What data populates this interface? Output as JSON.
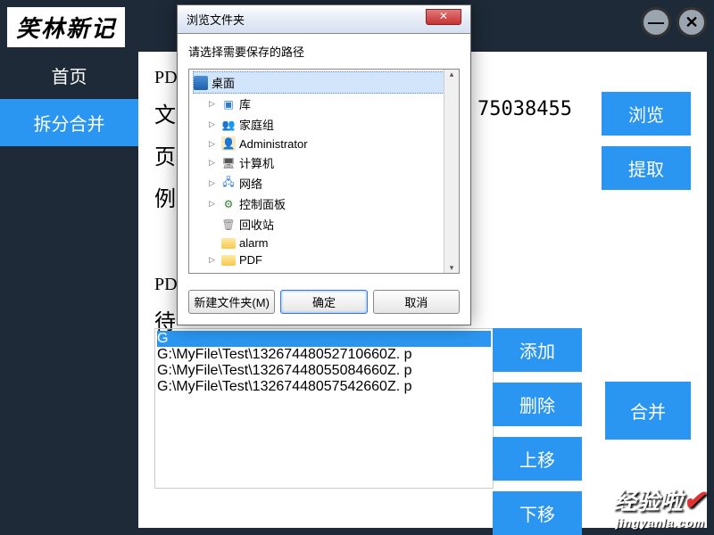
{
  "app": {
    "logo_text": "笑林新记"
  },
  "sidebar": {
    "items": [
      {
        "label": "首页"
      },
      {
        "label": "拆分合并"
      }
    ]
  },
  "main": {
    "section1_prefix": "PD",
    "row1_label": "文",
    "row2_label": "页",
    "row3_label": "例",
    "path_fragment": "75038455",
    "browse_btn": "浏览",
    "extract_btn": "提取",
    "section2_prefix": "PD",
    "section2_row_label": "待",
    "add_btn": "添加",
    "delete_btn": "删除",
    "up_btn": "上移",
    "down_btn": "下移",
    "merge_btn": "合并",
    "file_list": [
      "G",
      "G:\\MyFile\\Test\\13267448052710660Z. p",
      "G:\\MyFile\\Test\\13267448055084660Z. p",
      "G:\\MyFile\\Test\\13267448057542660Z. p"
    ]
  },
  "dialog": {
    "title": "浏览文件夹",
    "instruction": "请选择需要保存的路径",
    "tree": [
      {
        "label": "桌面",
        "type": "desktop",
        "root": true
      },
      {
        "label": "库",
        "type": "lib"
      },
      {
        "label": "家庭组",
        "type": "home"
      },
      {
        "label": "Administrator",
        "type": "user"
      },
      {
        "label": "计算机",
        "type": "pc"
      },
      {
        "label": "网络",
        "type": "net"
      },
      {
        "label": "控制面板",
        "type": "cp"
      },
      {
        "label": "回收站",
        "type": "bin"
      },
      {
        "label": "alarm",
        "type": "folder"
      },
      {
        "label": "PDF",
        "type": "folder"
      }
    ],
    "new_folder_btn": "新建文件夹(M)",
    "ok_btn": "确定",
    "cancel_btn": "取消"
  },
  "watermark": {
    "line1": "经验啦",
    "line2": "jingyanla.com"
  }
}
